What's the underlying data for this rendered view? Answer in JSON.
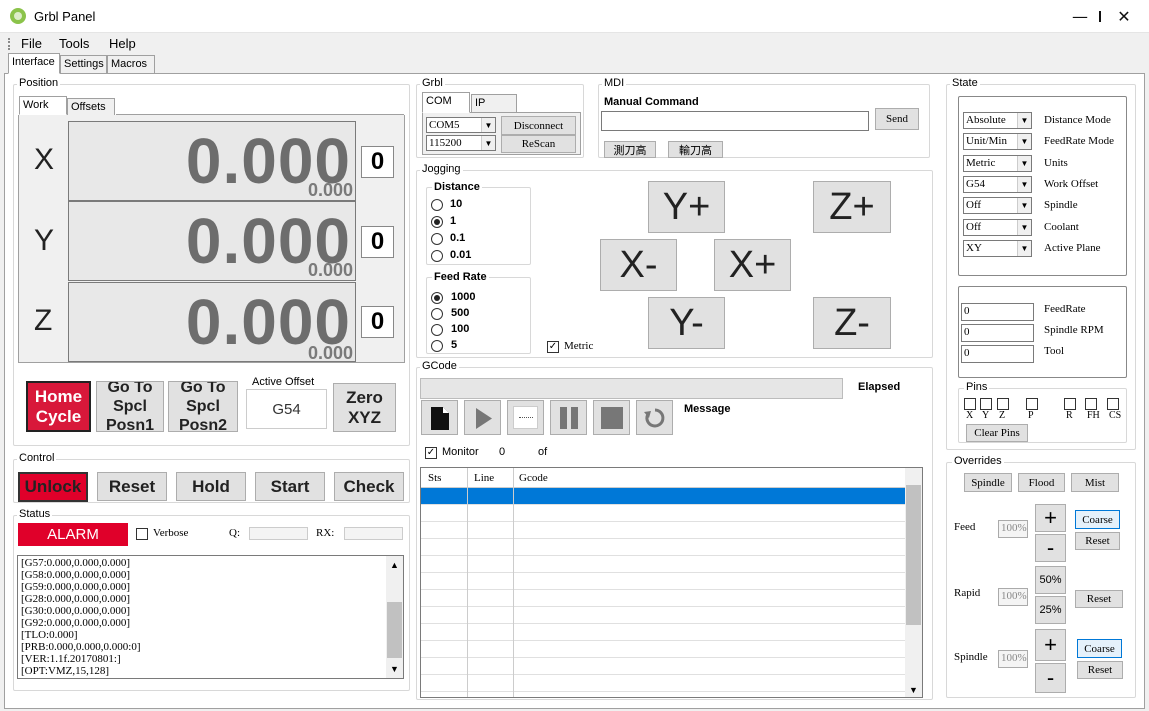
{
  "window": {
    "title": "Grbl Panel",
    "minimize": "—",
    "maximize": "☐",
    "close": "✕"
  },
  "menu": [
    "File",
    "Tools",
    "Help"
  ],
  "tabs": [
    "Interface",
    "Settings",
    "Macros"
  ],
  "position": {
    "label": "Position",
    "tabs": [
      "Work",
      "Offsets"
    ],
    "axes": [
      {
        "name": "X",
        "value": "0.000",
        "sub": "0.000",
        "zero": "0"
      },
      {
        "name": "Y",
        "value": "0.000",
        "sub": "0.000",
        "zero": "0"
      },
      {
        "name": "Z",
        "value": "0.000",
        "sub": "0.000",
        "zero": "0"
      }
    ],
    "home_cycle": "Home\nCycle",
    "goto1": "Go To\nSpcl\nPosn1",
    "goto2": "Go To\nSpcl\nPosn2",
    "active_offset_label": "Active Offset",
    "active_offset": "G54",
    "zero_xyz": "Zero\nXYZ"
  },
  "control": {
    "label": "Control",
    "buttons": [
      "Unlock",
      "Reset",
      "Hold",
      "Start",
      "Check"
    ]
  },
  "status": {
    "label": "Status",
    "alarm": "ALARM",
    "verbose": "Verbose",
    "q_label": "Q:",
    "rx_label": "RX:",
    "log": [
      "[G57:0.000,0.000,0.000]",
      "[G58:0.000,0.000,0.000]",
      "[G59:0.000,0.000,0.000]",
      "[G28:0.000,0.000,0.000]",
      "[G30:0.000,0.000,0.000]",
      "[G92:0.000,0.000,0.000]",
      "[TLO:0.000]",
      "[PRB:0.000,0.000,0.000:0]",
      "[VER:1.1f.20170801:]",
      "[OPT:VMZ,15,128]"
    ]
  },
  "grbl": {
    "label": "Grbl",
    "tabs": [
      "COM",
      "IP"
    ],
    "port": "COM5",
    "baud": "115200",
    "disconnect": "Disconnect",
    "rescan": "ReScan"
  },
  "mdi": {
    "label": "MDI",
    "manual_command": "Manual Command",
    "send": "Send",
    "btn1": "測刀高",
    "btn2": "輸刀高"
  },
  "jogging": {
    "label": "Jogging",
    "distance_label": "Distance",
    "distances": [
      "10",
      "1",
      "0.1",
      "0.01"
    ],
    "distance_selected": 1,
    "feed_label": "Feed Rate",
    "feeds": [
      "1000",
      "500",
      "100",
      "5"
    ],
    "feed_selected": 0,
    "metric": "Metric",
    "buttons": {
      "yplus": "Y+",
      "zplus": "Z+",
      "xminus": "X-",
      "xplus": "X+",
      "yminus": "Y-",
      "zminus": "Z-"
    }
  },
  "gcode": {
    "label": "GCode",
    "elapsed": "Elapsed",
    "message": "Message",
    "monitor": "Monitor",
    "count": "0",
    "of": "of",
    "columns": [
      "Sts",
      "Line",
      "Gcode"
    ]
  },
  "state": {
    "label": "State",
    "rows": [
      {
        "value": "Absolute",
        "label": "Distance Mode"
      },
      {
        "value": "Unit/Min",
        "label": "FeedRate Mode"
      },
      {
        "value": "Metric",
        "label": "Units"
      },
      {
        "value": "G54",
        "label": "Work Offset"
      },
      {
        "value": "Off",
        "label": "Spindle"
      },
      {
        "value": "Off",
        "label": "Coolant"
      },
      {
        "value": "XY",
        "label": "Active Plane"
      }
    ],
    "readouts": [
      {
        "value": "0",
        "label": "FeedRate"
      },
      {
        "value": "0",
        "label": "Spindle RPM"
      },
      {
        "value": "0",
        "label": "Tool"
      }
    ]
  },
  "pins": {
    "label": "Pins",
    "items": [
      "X",
      "Y",
      "Z",
      "P",
      "R",
      "FH",
      "CS"
    ],
    "clear": "Clear Pins"
  },
  "overrides": {
    "label": "Overrides",
    "spindle": "Spindle",
    "flood": "Flood",
    "mist": "Mist",
    "feed_label": "Feed",
    "feed_value": "100%",
    "rapid_label": "Rapid",
    "rapid_value": "100%",
    "spindle_label": "Spindle",
    "spindle_value": "100%",
    "plus": "+",
    "minus": "-",
    "coarse": "Coarse",
    "reset": "Reset",
    "p50": "50%",
    "p25": "25%"
  },
  "colors": {
    "alarm_red": "#e0002a",
    "home_red": "#d8183a",
    "selection_blue": "#0078d7"
  }
}
